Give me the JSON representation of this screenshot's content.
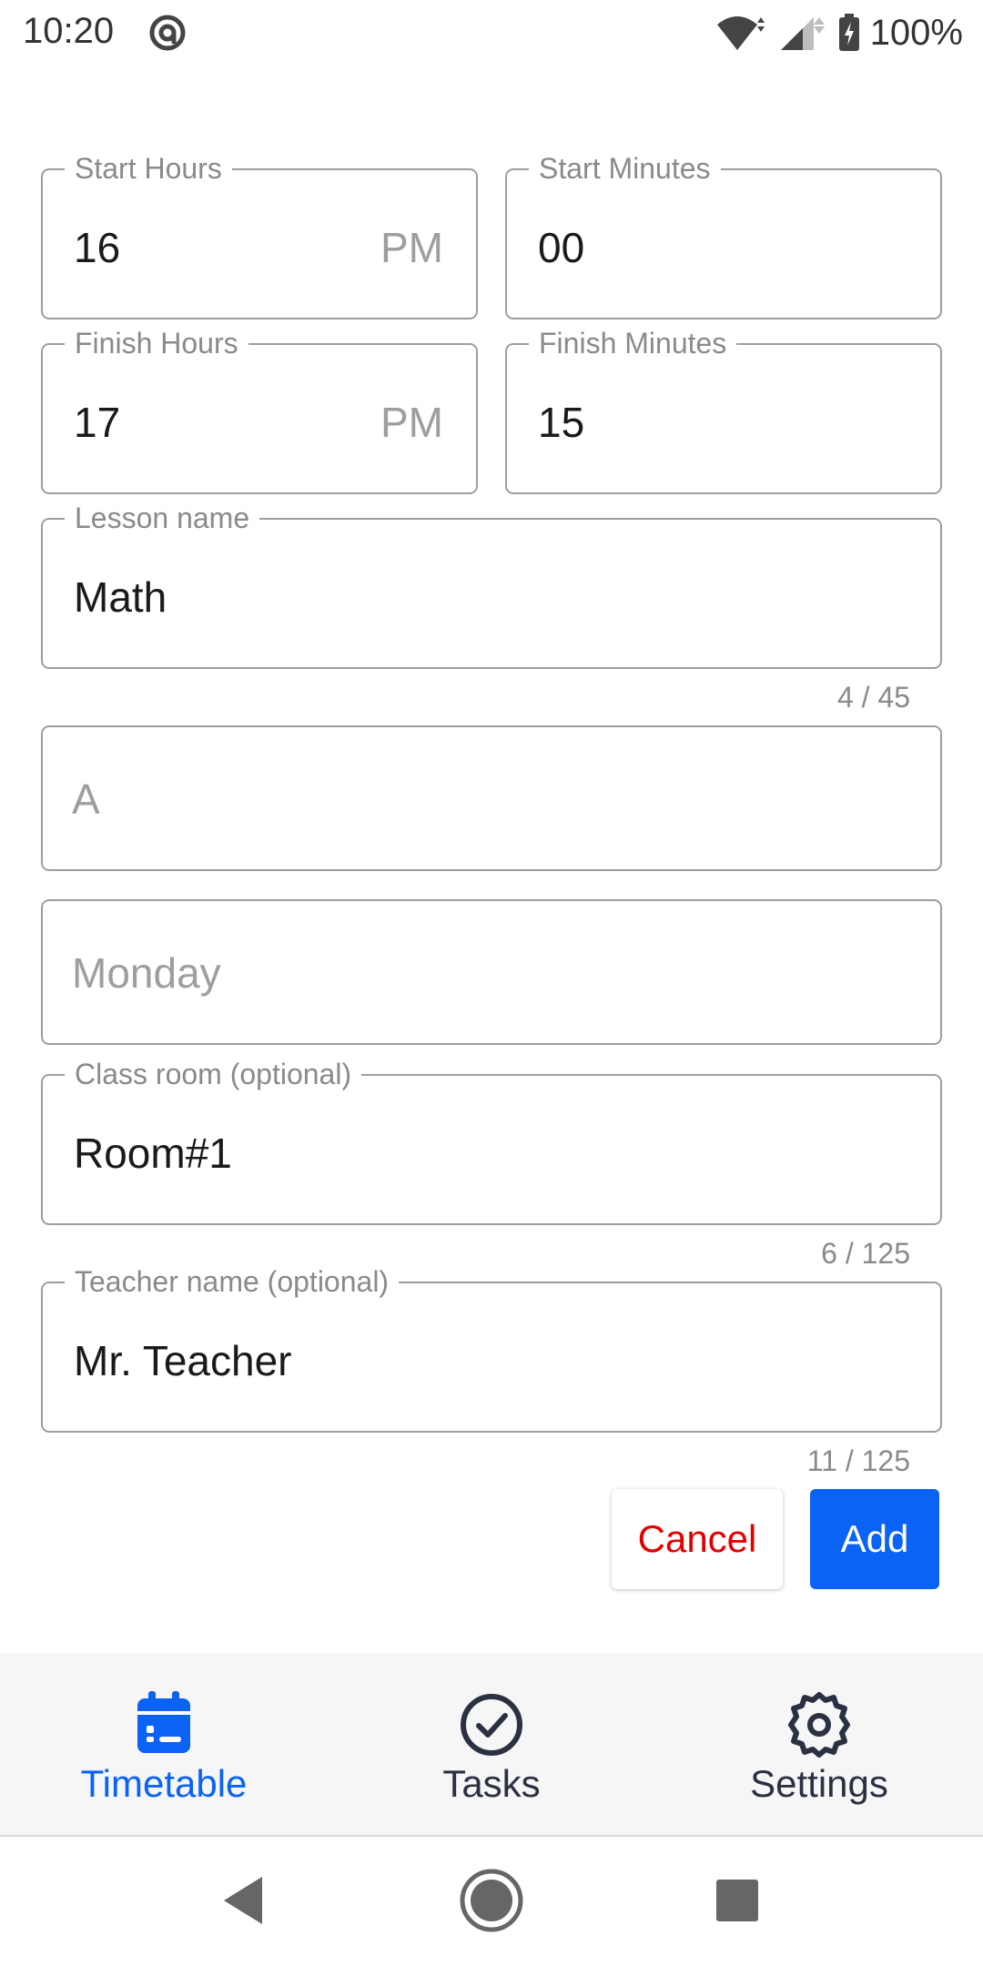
{
  "status_bar": {
    "time": "10:20",
    "battery": "100%"
  },
  "form": {
    "start_hours": {
      "label": "Start Hours",
      "value": "16",
      "suffix": "PM"
    },
    "start_minutes": {
      "label": "Start Minutes",
      "value": "00"
    },
    "finish_hours": {
      "label": "Finish Hours",
      "value": "17",
      "suffix": "PM"
    },
    "finish_minutes": {
      "label": "Finish Minutes",
      "value": "15"
    },
    "lesson_name": {
      "label": "Lesson name",
      "value": "Math",
      "counter": "4 / 45"
    },
    "week_type": {
      "placeholder": "A"
    },
    "day": {
      "placeholder": "Monday"
    },
    "class_room": {
      "label": "Class room (optional)",
      "value": "Room#1",
      "counter": "6 / 125"
    },
    "teacher_name": {
      "label": "Teacher name (optional)",
      "value": "Mr. Teacher",
      "counter": "11 / 125"
    }
  },
  "actions": {
    "cancel": "Cancel",
    "add": "Add"
  },
  "bottom_nav": {
    "items": [
      {
        "label": "Timetable",
        "icon": "calendar-icon",
        "active": true
      },
      {
        "label": "Tasks",
        "icon": "check-circle-icon",
        "active": false
      },
      {
        "label": "Settings",
        "icon": "gear-icon",
        "active": false
      }
    ]
  },
  "colors": {
    "accent": "#0a63f5",
    "cancel": "#e50000",
    "nav_icon": "#2b3142"
  }
}
